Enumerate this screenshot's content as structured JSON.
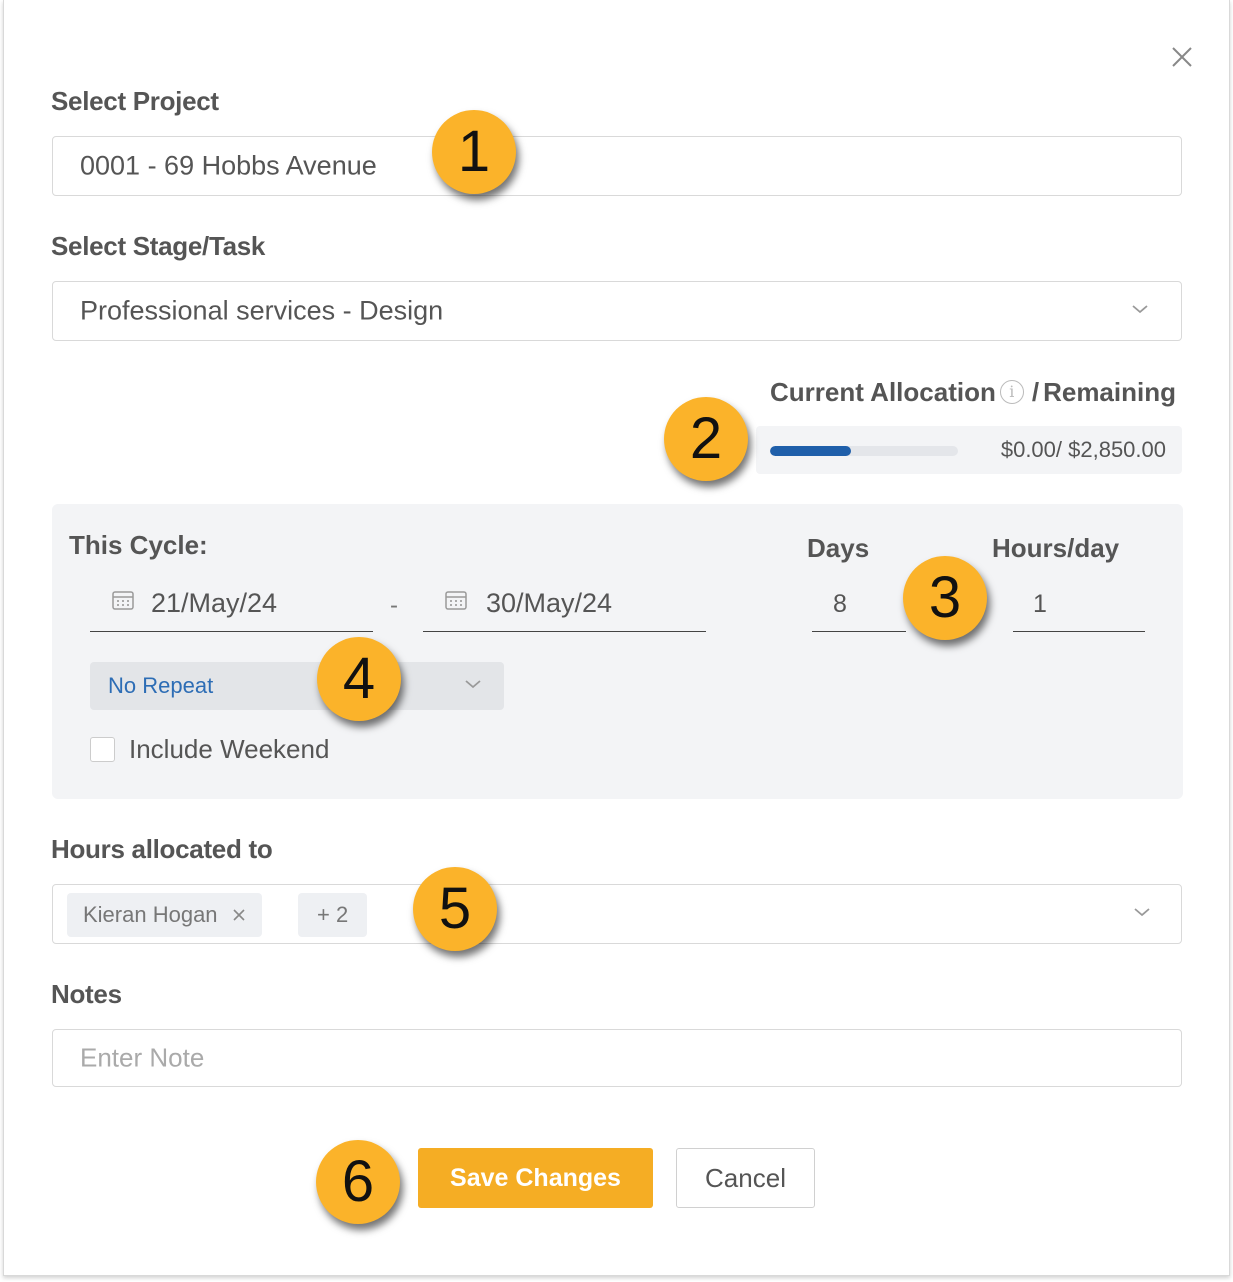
{
  "project": {
    "label": "Select Project",
    "value": "0001 - 69 Hobbs Avenue"
  },
  "stage": {
    "label": "Select Stage/Task",
    "value": "Professional services - Design"
  },
  "allocation": {
    "label_current": "Current Allocation",
    "separator": "/",
    "label_remaining": "Remaining",
    "info_icon": "i",
    "text": "$0.00/ $2,850.00",
    "progress_fraction": 0.43,
    "progress_color": "#1f5faa"
  },
  "cycle": {
    "label": "This Cycle:",
    "start_date": "21/May/24",
    "date_separator": "-",
    "end_date": "30/May/24",
    "days_label": "Days",
    "days_value": "8",
    "hours_label": "Hours/day",
    "hours_value": "1",
    "repeat_value": "No Repeat",
    "include_weekend_label": "Include Weekend"
  },
  "assignees": {
    "label": "Hours allocated to",
    "tags": [
      "Kieran Hogan"
    ],
    "more": "+ 2"
  },
  "notes": {
    "label": "Notes",
    "placeholder": "Enter Note"
  },
  "buttons": {
    "save": "Save Changes",
    "cancel": "Cancel"
  },
  "badges": [
    "1",
    "2",
    "3",
    "4",
    "5",
    "6"
  ],
  "colors": {
    "accent": "#f5ad24",
    "badge": "#fbb32a",
    "link_blue": "#2d6db5"
  }
}
